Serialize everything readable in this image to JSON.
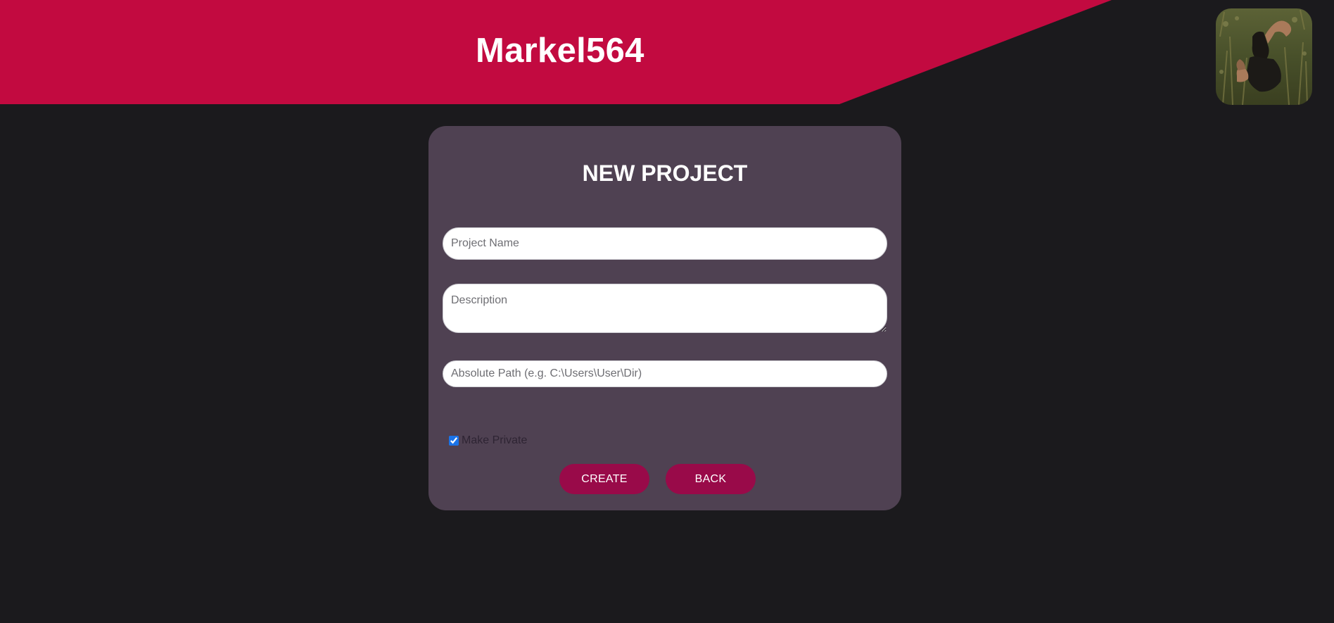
{
  "header": {
    "username": "Markel564",
    "banner_color": "#c20a40",
    "avatar": "profile-photo"
  },
  "form": {
    "title": "NEW PROJECT",
    "project_name_placeholder": "Project Name",
    "description_placeholder": "Description",
    "path_placeholder": "Absolute Path (e.g. C:\\Users\\User\\Dir)",
    "make_private_label": "Make Private",
    "make_private_checked": true
  },
  "buttons": {
    "create_label": "CREATE",
    "back_label": "BACK",
    "color": "#990a49"
  },
  "colors": {
    "page_background": "#1b1a1d",
    "card_background": "#4f4152"
  }
}
